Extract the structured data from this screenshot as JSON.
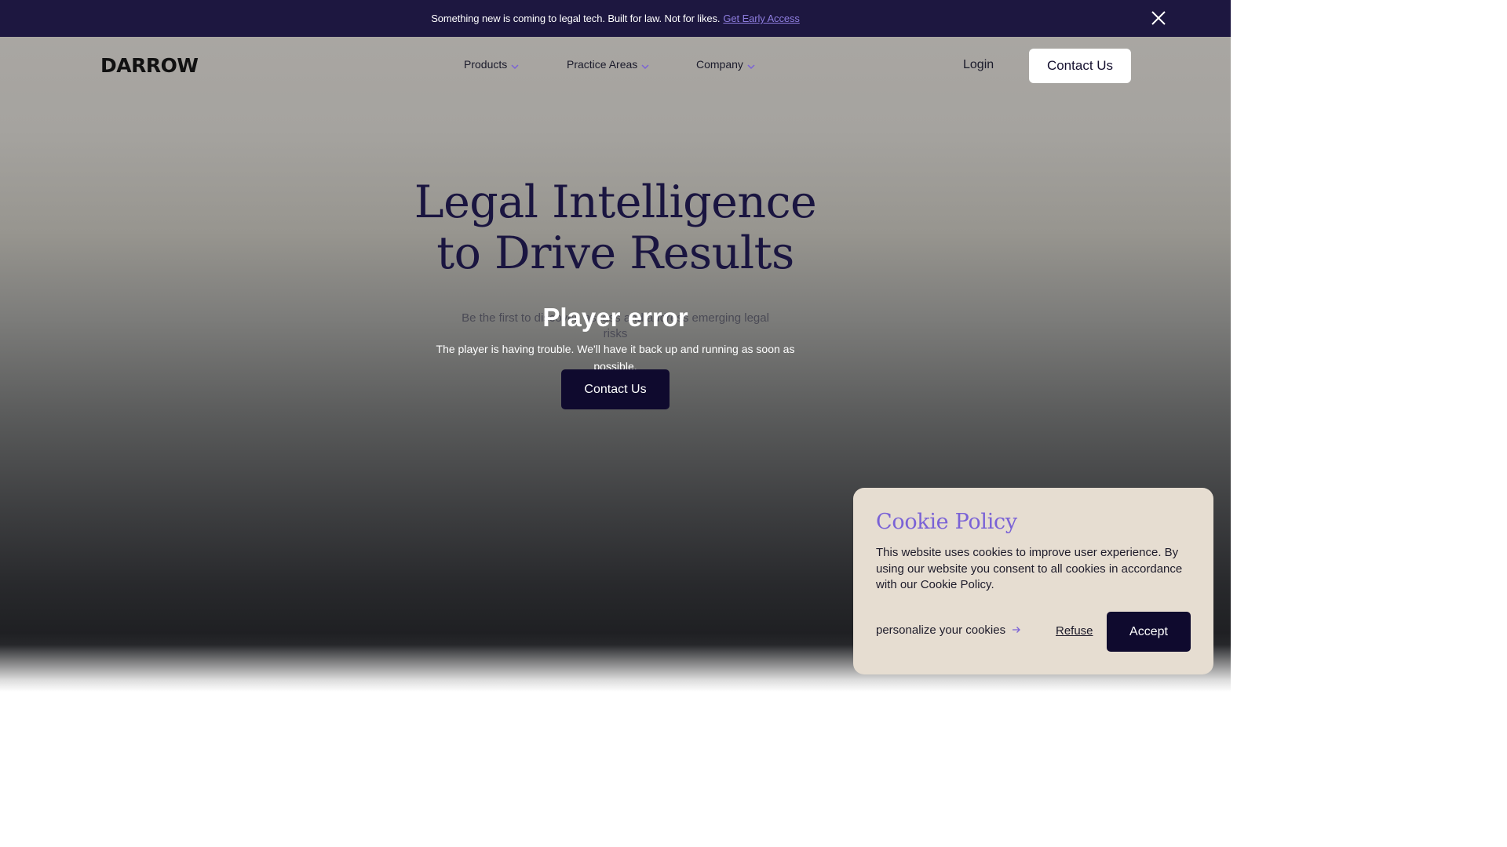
{
  "announcement": {
    "message": "Something new is coming to legal tech. Built for law. Not for likes.",
    "link_label": "Get Early Access",
    "close_icon": "close-icon"
  },
  "header": {
    "logo": "DARROW",
    "nav": [
      {
        "label": "Products",
        "icon": "chevron-down-icon"
      },
      {
        "label": "Practice Areas",
        "icon": "chevron-down-icon"
      },
      {
        "label": "Company",
        "icon": "chevron-down-icon"
      }
    ],
    "login_label": "Login",
    "contact_label": "Contact Us"
  },
  "hero": {
    "headline_line1": "Legal Intelligence",
    "headline_line2": "to Drive Results",
    "subtitle": "Be the first to discover, assess and address emerging legal risks",
    "player_error_title": "Player error",
    "player_error_message": "The player is having trouble. We'll have it back up and running as soon as possible.",
    "cta_label": "Contact Us"
  },
  "cookie": {
    "title": "Cookie Policy",
    "text": "This website uses cookies to improve user experience.  By using our website you consent to all cookies in accordance with our Cookie Policy.",
    "personalize_label": "personalize your cookies",
    "personalize_icon": "arrow-right-icon",
    "refuse_label": "Refuse",
    "accept_label": "Accept"
  },
  "colors": {
    "announce_bg": "#1d1740",
    "link": "#8f7ee0",
    "headline": "#1a1540",
    "cta_bg": "#0f0a2e",
    "cookie_bg": "#e6ddd1",
    "cookie_title": "#7a62d6"
  }
}
